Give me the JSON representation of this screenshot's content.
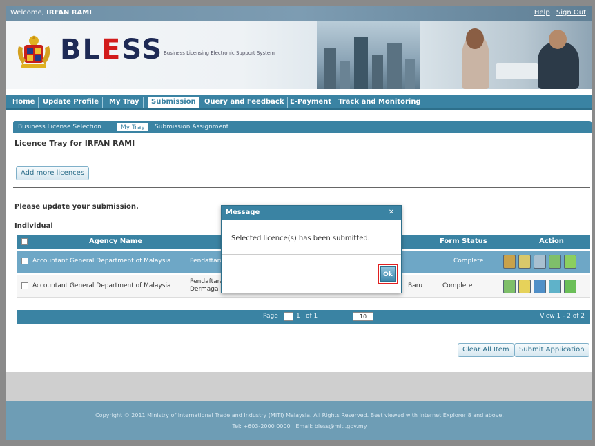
{
  "header": {
    "welcome_prefix": "Welcome,",
    "user_name": "IRFAN RAMI",
    "links": [
      "Help",
      "Sign Out"
    ],
    "logo_text": "BL",
    "logo_e": "E",
    "logo_tail": "SS",
    "tagline": "Business Licensing Electronic Support System"
  },
  "menu": {
    "items": [
      "Home",
      "Update Profile",
      "My Tray",
      "Submission",
      "Query and Feedback",
      "E-Payment",
      "Track and Monitoring"
    ],
    "active": "Submission"
  },
  "submenu": {
    "items": [
      "Business License Selection",
      "My Tray",
      "Submission Assignment"
    ],
    "active": "My Tray"
  },
  "page": {
    "title": "Licence Tray for IRFAN RAMI",
    "add_button": "Add more licences",
    "note": "Please update your submission.",
    "section": "Individual"
  },
  "grid": {
    "columns": [
      "Agency Name",
      "Form Status",
      "Action"
    ],
    "rows": [
      {
        "agency": "Accountant General Department of Malaysia",
        "license": "Pendaftaran",
        "status": "Complete"
      },
      {
        "agency": "Accountant General Department of Malaysia",
        "license": "Pendaftaran Dermaga",
        "extra": "Baru",
        "status": "Complete"
      }
    ],
    "pager": {
      "page_label": "Page",
      "page_value": "1",
      "of_label": "of 1",
      "page_size": "10",
      "view": "View 1 - 2 of 2"
    }
  },
  "buttons": {
    "clear": "Clear All Item",
    "submit": "Submit Application"
  },
  "footer": {
    "line1": "Copyright © 2011 Ministry of International Trade and Industry (MITI) Malaysia. All Rights Reserved. Best viewed with Internet Explorer 8 and above.",
    "line2": "Tel: +603-2000 0000 | Email: bless@miti.gov.my"
  },
  "modal": {
    "title": "Message",
    "message": "Selected licence(s) has been submitted.",
    "ok": "Ok"
  },
  "colors": {
    "primary": "#3a83a3",
    "accent_red": "#e02020",
    "selected_row": "#6ea7c6"
  }
}
